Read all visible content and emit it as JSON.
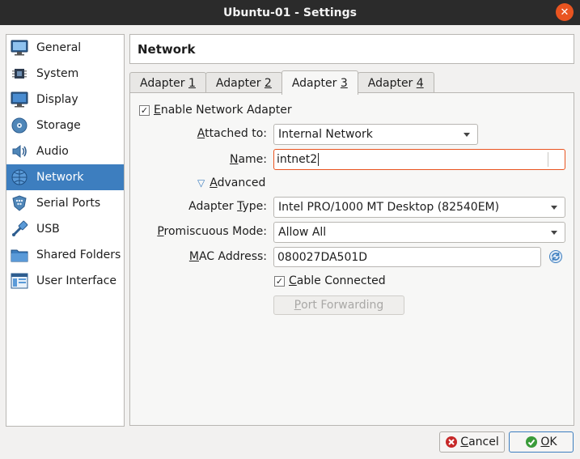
{
  "window": {
    "title": "Ubuntu-01 - Settings",
    "close_glyph": "✕"
  },
  "sidebar": {
    "items": [
      {
        "label": "General",
        "icon": "monitor-general-icon"
      },
      {
        "label": "System",
        "icon": "chip-icon"
      },
      {
        "label": "Display",
        "icon": "display-icon"
      },
      {
        "label": "Storage",
        "icon": "disk-icon"
      },
      {
        "label": "Audio",
        "icon": "speaker-icon"
      },
      {
        "label": "Network",
        "icon": "network-icon",
        "active": true
      },
      {
        "label": "Serial Ports",
        "icon": "serial-port-icon"
      },
      {
        "label": "USB",
        "icon": "usb-icon"
      },
      {
        "label": "Shared Folders",
        "icon": "folder-icon"
      },
      {
        "label": "User Interface",
        "icon": "user-interface-icon"
      }
    ]
  },
  "header": {
    "title": "Network"
  },
  "tabs": [
    {
      "prefix": "Adapter ",
      "mnemonic": "1"
    },
    {
      "prefix": "Adapter ",
      "mnemonic": "2"
    },
    {
      "prefix": "Adapter ",
      "mnemonic": "3",
      "active": true
    },
    {
      "prefix": "Adapter ",
      "mnemonic": "4"
    }
  ],
  "form": {
    "enable_adapter": {
      "mnemonic": "E",
      "rest": "nable Network Adapter",
      "checked": true,
      "check_glyph": "✓"
    },
    "attached_to": {
      "mnemonic": "A",
      "rest": "ttached to:",
      "value": "Internal Network"
    },
    "name": {
      "mnemonic": "N",
      "rest": "ame:",
      "value": "intnet2"
    },
    "advanced": {
      "mnemonic": "A",
      "rest": "dvanced",
      "expanded_glyph": "▽"
    },
    "adapter_type": {
      "pre": "Adapter ",
      "mnemonic": "T",
      "rest": "ype:",
      "value": "Intel PRO/1000 MT Desktop (82540EM)"
    },
    "promiscuous_mode": {
      "mnemonic": "P",
      "rest": "romiscuous Mode:",
      "value": "Allow All"
    },
    "mac_address": {
      "mnemonic": "M",
      "rest": "AC Address:",
      "value": "080027DA501D"
    },
    "cable_connected": {
      "mnemonic": "C",
      "rest": "able Connected",
      "checked": true,
      "check_glyph": "✓"
    },
    "port_forwarding": {
      "mnemonic": "P",
      "rest": "ort Forwarding"
    }
  },
  "footer": {
    "cancel": {
      "mnemonic": "C",
      "rest": "ancel"
    },
    "ok": {
      "mnemonic": "O",
      "rest": "K"
    }
  },
  "colors": {
    "accent": "#e95420",
    "selection": "#3d7ebf",
    "ok_green": "#3a9b3a",
    "cancel_red": "#c62828"
  }
}
